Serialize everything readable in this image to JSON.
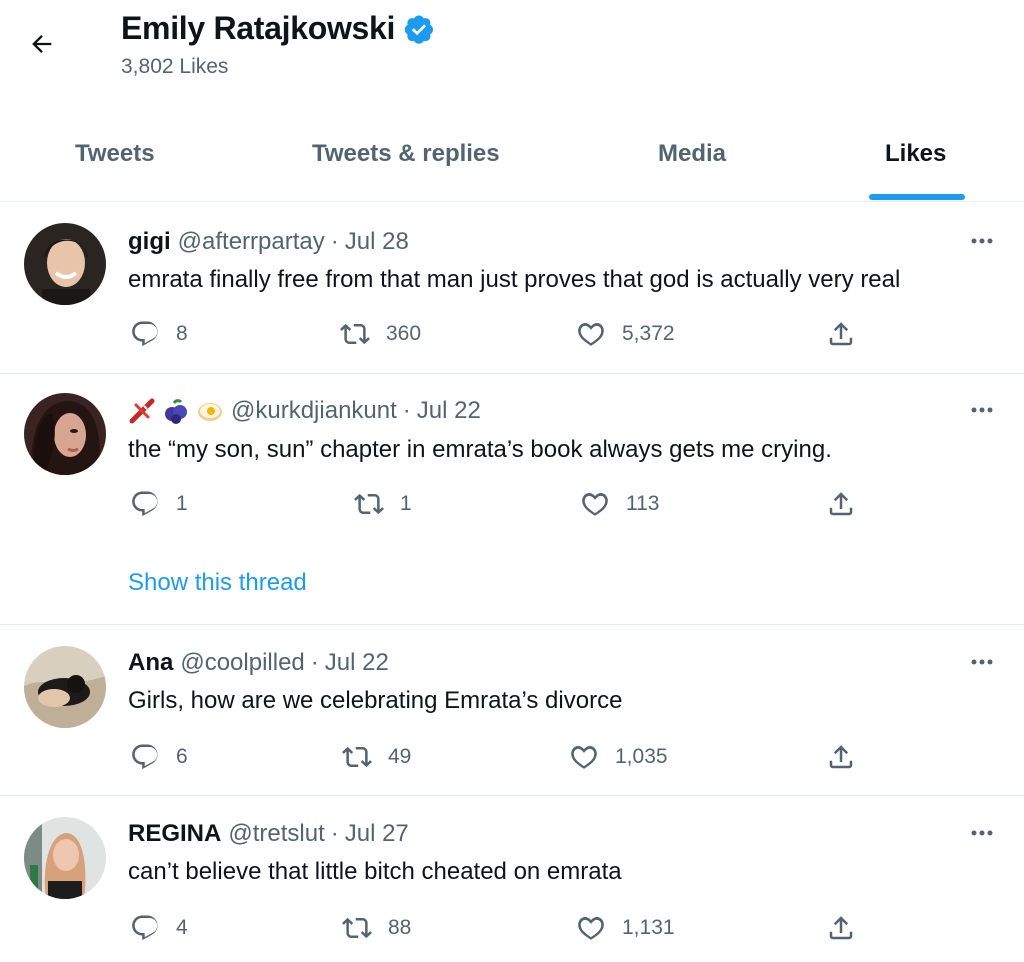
{
  "header": {
    "title": "Emily Ratajkowski",
    "subtitle": "3,802 Likes",
    "icons": {
      "back": "back-arrow-icon",
      "verified": "verified-badge-icon"
    }
  },
  "tabs": [
    {
      "label": "Tweets",
      "active": false
    },
    {
      "label": "Tweets & replies",
      "active": false
    },
    {
      "label": "Media",
      "active": false
    },
    {
      "label": "Likes",
      "active": true
    }
  ],
  "tweets": [
    {
      "name": "gigi",
      "handle": "@afterrpartay",
      "dot": "·",
      "date": "Jul 28",
      "text": "emrata finally free from that man just proves that god is actually very real",
      "replies": "8",
      "retweets": "360",
      "likes": "5,372"
    },
    {
      "name": "",
      "name_emojis": [
        "plane-emoji",
        "blueberries-emoji",
        "egg-emoji"
      ],
      "handle": "@kurkdjiankunt",
      "dot": "·",
      "date": "Jul 22",
      "text": "the “my son, sun” chapter in emrata’s book always gets me crying.",
      "replies": "1",
      "retweets": "1",
      "likes": "113",
      "thread_link": "Show this thread"
    },
    {
      "name": "Ana",
      "handle": "@coolpilled",
      "dot": "·",
      "date": "Jul 22",
      "text": "Girls, how are we celebrating Emrata’s divorce",
      "replies": "6",
      "retweets": "49",
      "likes": "1,035"
    },
    {
      "name": "REGINA",
      "handle": "@tretslut",
      "dot": "·",
      "date": "Jul 27",
      "text": "can’t believe that little bitch cheated on emrata",
      "replies": "4",
      "retweets": "88",
      "likes": "1,131"
    }
  ],
  "colors": {
    "accent": "#1d9bf0",
    "secondary_text": "#536471",
    "primary_text": "#0f1419"
  },
  "icons": {
    "reply": "reply-icon",
    "retweet": "retweet-icon",
    "like": "heart-icon",
    "share": "share-icon",
    "more": "more-icon"
  }
}
